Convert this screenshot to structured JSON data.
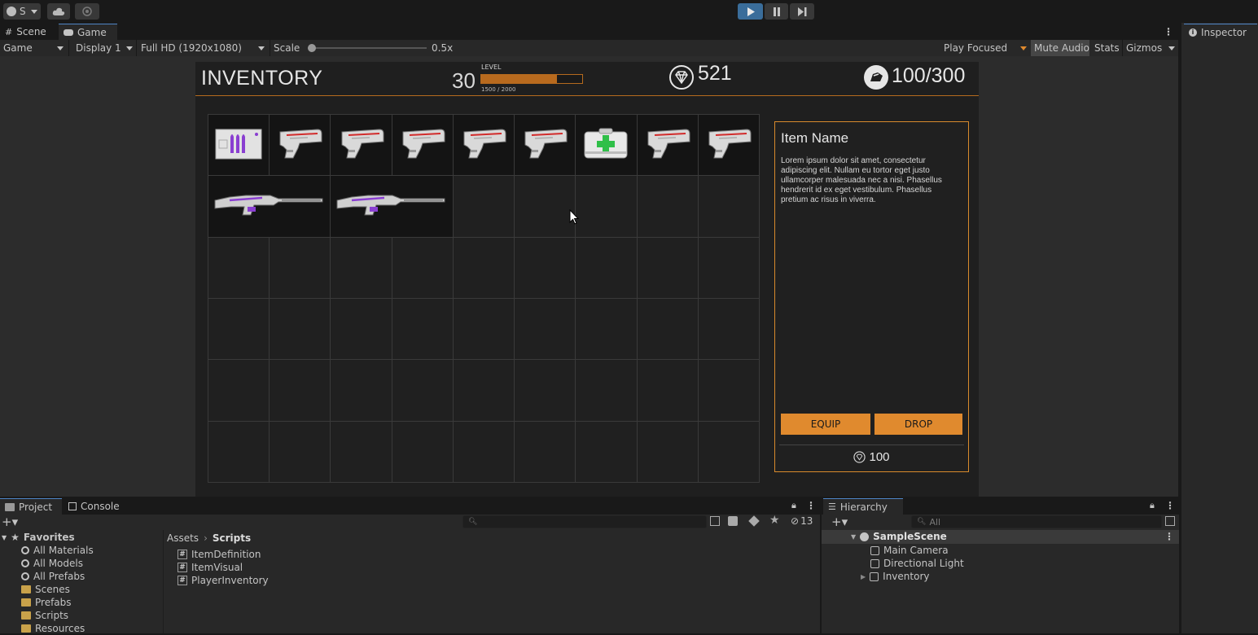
{
  "toolbar": {
    "account_label": "S",
    "cloud_icon": "cloud-icon",
    "collab_icon": "collab-icon",
    "play_icon": "play-icon",
    "pause_icon": "pause-icon",
    "step_icon": "step-icon"
  },
  "tabs": {
    "scene": "Scene",
    "game": "Game",
    "inspector": "Inspector"
  },
  "gamebar": {
    "mode": "Game",
    "display": "Display 1",
    "resolution": "Full HD (1920x1080)",
    "scale_label": "Scale",
    "scale_value": "0.5x",
    "scale_fraction": 0,
    "play_focused": "Play Focused",
    "mute_audio": "Mute Audio",
    "stats": "Stats",
    "gizmos": "Gizmos"
  },
  "game": {
    "title": "INVENTORY",
    "level_number": "30",
    "level_label": "LEVEL",
    "xp_text": "1500 / 2000",
    "xp_fraction": 0.75,
    "gems": "521",
    "weight": "100/300",
    "grid": {
      "rows": 6,
      "cols": 9,
      "items": [
        {
          "type": "ammo-box",
          "row": 0,
          "col": 0,
          "w": 1
        },
        {
          "type": "pistol",
          "row": 0,
          "col": 1,
          "w": 1
        },
        {
          "type": "pistol",
          "row": 0,
          "col": 2,
          "w": 1
        },
        {
          "type": "pistol",
          "row": 0,
          "col": 3,
          "w": 1
        },
        {
          "type": "pistol",
          "row": 0,
          "col": 4,
          "w": 1
        },
        {
          "type": "pistol",
          "row": 0,
          "col": 5,
          "w": 1
        },
        {
          "type": "medkit",
          "row": 0,
          "col": 6,
          "w": 1
        },
        {
          "type": "pistol",
          "row": 0,
          "col": 7,
          "w": 1
        },
        {
          "type": "pistol",
          "row": 0,
          "col": 8,
          "w": 1
        },
        {
          "type": "rifle",
          "row": 1,
          "col": 0,
          "w": 2
        },
        {
          "type": "rifle",
          "row": 1,
          "col": 2,
          "w": 2
        }
      ]
    },
    "detail": {
      "name": "Item Name",
      "description": "Lorem ipsum dolor sit amet, consectetur adipiscing elit. Nullam eu tortor eget justo ullamcorper malesuada nec a nisi. Phasellus hendrerit id ex eget vestibulum. Phasellus pretium ac risus in viverra.",
      "equip": "EQUIP",
      "drop": "DROP",
      "price": "100"
    }
  },
  "project": {
    "tab_project": "Project",
    "tab_console": "Console",
    "hidden_count": "13",
    "favorites_label": "Favorites",
    "favorites": [
      "All Materials",
      "All Models",
      "All Prefabs"
    ],
    "folders": [
      "Scenes",
      "Prefabs",
      "Scripts",
      "Resources"
    ],
    "breadcrumb_root": "Assets",
    "breadcrumb_current": "Scripts",
    "files": [
      "ItemDefinition",
      "ItemVisual",
      "PlayerInventory"
    ]
  },
  "hierarchy": {
    "tab": "Hierarchy",
    "search_placeholder": "All",
    "scene": "SampleScene",
    "objects": [
      "Main Camera",
      "Directional Light",
      "Inventory"
    ]
  },
  "colors": {
    "accent_orange": "#e08a2e",
    "play_blue": "#3a6d9a",
    "panel": "#282828",
    "xp_fill": "#b86a1e"
  }
}
